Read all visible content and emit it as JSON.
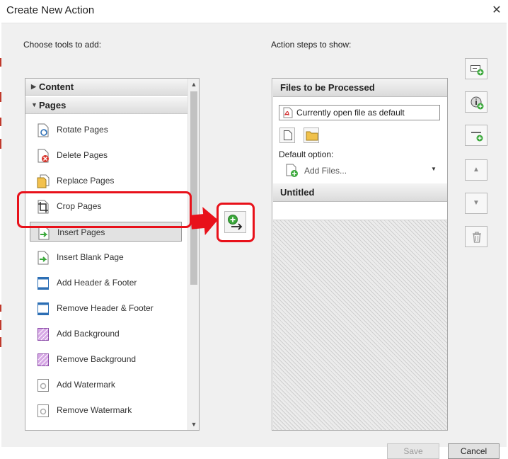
{
  "window": {
    "title": "Create New Action",
    "close_label": "✕"
  },
  "tools": {
    "heading": "Choose tools to add:",
    "categories": [
      {
        "label": "Content",
        "expanded": false
      },
      {
        "label": "Pages",
        "expanded": true
      }
    ],
    "items": [
      {
        "label": "Rotate Pages",
        "icon": "rotate-pages-icon"
      },
      {
        "label": "Delete Pages",
        "icon": "delete-pages-icon"
      },
      {
        "label": "Replace Pages",
        "icon": "replace-pages-icon"
      },
      {
        "label": "Crop Pages",
        "icon": "crop-pages-icon"
      },
      {
        "label": "Insert Pages",
        "icon": "insert-pages-icon",
        "selected": true
      },
      {
        "label": "Insert Blank Page",
        "icon": "insert-blank-page-icon"
      },
      {
        "label": "Add Header & Footer",
        "icon": "add-header-footer-icon"
      },
      {
        "label": "Remove Header & Footer",
        "icon": "remove-header-footer-icon"
      },
      {
        "label": "Add Background",
        "icon": "add-background-icon"
      },
      {
        "label": "Remove Background",
        "icon": "remove-background-icon"
      },
      {
        "label": "Add Watermark",
        "icon": "add-watermark-icon"
      },
      {
        "label": "Remove Watermark",
        "icon": "remove-watermark-icon"
      }
    ]
  },
  "steps": {
    "heading": "Action steps to show:",
    "files_section": {
      "title": "Files to be Processed",
      "file_value": "Currently open file as default",
      "default_option_label": "Default option:",
      "default_option_value": "Add Files..."
    },
    "untitled_title": "Untitled"
  },
  "buttons": {
    "save": "Save",
    "cancel": "Cancel"
  },
  "colors": {
    "highlight": "#e8111a",
    "accent_green": "#3aa83a"
  }
}
